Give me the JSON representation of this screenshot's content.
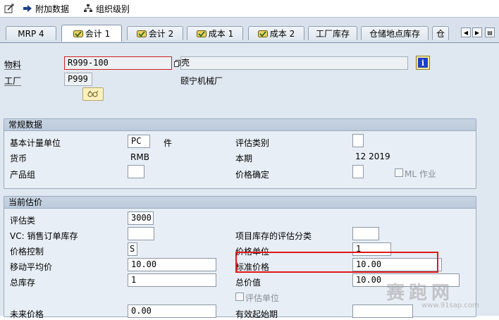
{
  "toolbar": {
    "additional_data": "附加数据",
    "org_levels": "组织级别"
  },
  "tabs": [
    {
      "label": "MRP 4"
    },
    {
      "label": "会计 1"
    },
    {
      "label": "会计 2"
    },
    {
      "label": "成本 1"
    },
    {
      "label": "成本 2"
    },
    {
      "label": "工厂库存"
    },
    {
      "label": "仓储地点库存"
    },
    {
      "label": "仓"
    }
  ],
  "header": {
    "material_label": "物料",
    "material_value": "R999-100",
    "material_desc": "壳",
    "plant_label": "工厂",
    "plant_value": "P999",
    "plant_name": "颐宁机械厂"
  },
  "general": {
    "title": "常规数据",
    "base_uom_label": "基本计量单位",
    "base_uom_value": "PC",
    "base_uom_text": "件",
    "valuation_category_label": "评估类别",
    "currency_label": "货币",
    "currency_value": "RMB",
    "current_period_label": "本期",
    "current_period_value": "12 2019",
    "product_group_label": "产品组",
    "price_determination_label": "价格确定",
    "ml_label": "ML 作业"
  },
  "valuation": {
    "title": "当前估价",
    "valuation_class_label": "评估类",
    "valuation_class_value": "3000",
    "vc_sales_label": "VC: 销售订单库存",
    "proj_stock_label": "项目库存的评估分类",
    "price_control_label": "价格控制",
    "price_control_value": "S",
    "price_unit_label": "价格单位",
    "price_unit_value": "1",
    "moving_avg_label": "移动平均价",
    "moving_avg_value": "10.00",
    "std_price_label": "标准价格",
    "std_price_value": "10.00",
    "total_stock_label": "总库存",
    "total_stock_value": "1",
    "total_value_label": "总价值",
    "total_value_value": "10.00",
    "valuated_unit_label": "评估单位",
    "future_price_label": "未来价格",
    "future_price_value": "0.00",
    "valid_from_label": "有效起始期"
  },
  "watermark": {
    "text": "赛跑网",
    "url": "www.91sap.com"
  },
  "colors": {
    "tab_strip": "#d9e2ec",
    "content_bg": "#dfe7f0",
    "group_header": "#c4d1e0",
    "highlight": "#e01818",
    "info_button": "#1e3fc8"
  }
}
